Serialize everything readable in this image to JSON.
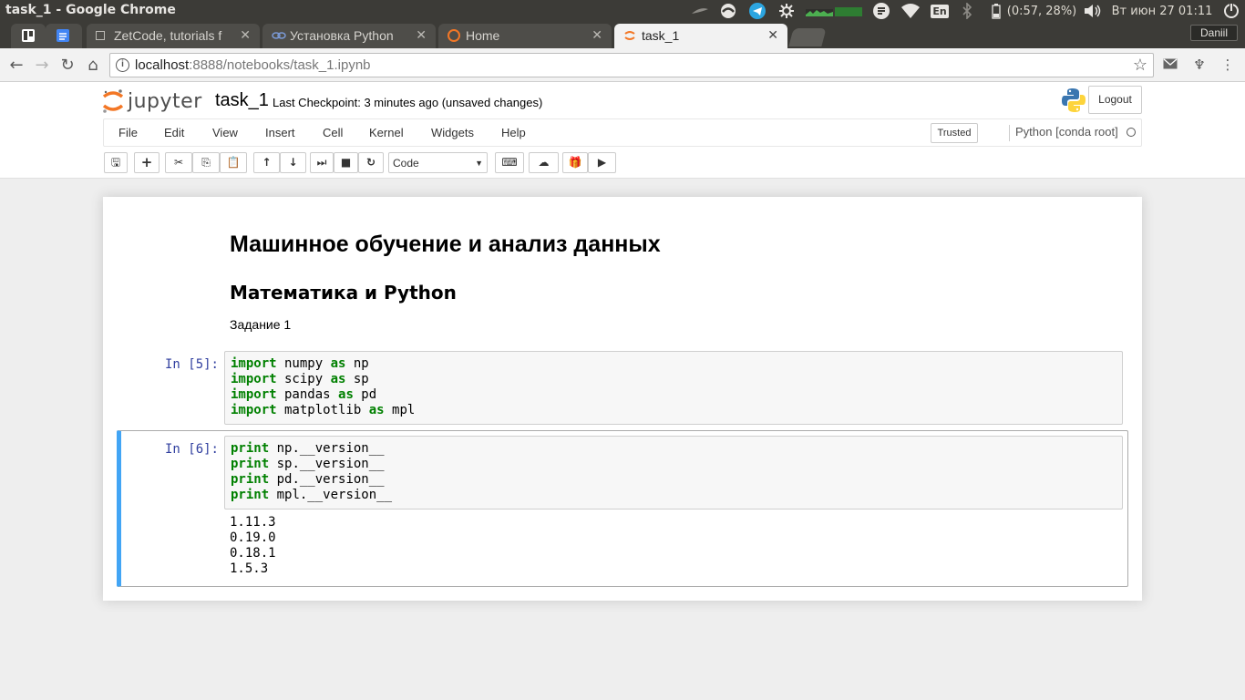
{
  "os": {
    "window_title": "task_1 - Google Chrome",
    "keyboard_layout": "En",
    "battery": "(0:57, 28%)",
    "datetime": "Вт июн 27 01:11"
  },
  "browser": {
    "tabs": [
      {
        "label": "",
        "favicon": "trello-icon"
      },
      {
        "label": "",
        "favicon": "docs-icon"
      },
      {
        "label": "ZetCode, tutorials f",
        "favicon": "zetcode-icon"
      },
      {
        "label": "Установка Python",
        "favicon": "python-site-icon"
      },
      {
        "label": "Home",
        "favicon": "jupyter-icon"
      },
      {
        "label": "task_1",
        "favicon": "jupyter-icon",
        "active": true
      }
    ],
    "user": "Daniil",
    "url_host": "localhost",
    "url_rest": ":8888/notebooks/task_1.ipynb"
  },
  "jupyter": {
    "wordmark": "jupyter",
    "notebook_name": "task_1",
    "checkpoint": "Last Checkpoint: 3 minutes ago (unsaved changes)",
    "logout": "Logout",
    "menu": [
      "File",
      "Edit",
      "View",
      "Insert",
      "Cell",
      "Kernel",
      "Widgets",
      "Help"
    ],
    "trusted": "Trusted",
    "kernel": "Python [conda root]",
    "cell_type": "Code"
  },
  "notebook": {
    "h1": "Машинное обучение и анализ данных",
    "h2": "Математика и Python",
    "paragraph": "Задание 1",
    "cell1": {
      "prompt": "In [5]:",
      "lines": [
        {
          "kw": "import",
          "a": " numpy ",
          "kw2": "as",
          "b": " np"
        },
        {
          "kw": "import",
          "a": " scipy ",
          "kw2": "as",
          "b": " sp"
        },
        {
          "kw": "import",
          "a": " pandas ",
          "kw2": "as",
          "b": " pd"
        },
        {
          "kw": "import",
          "a": " matplotlib ",
          "kw2": "as",
          "b": " mpl"
        }
      ]
    },
    "cell2": {
      "prompt": "In [6]:",
      "lines": [
        {
          "kw": "print",
          "a": " np.__version__"
        },
        {
          "kw": "print",
          "a": " sp.__version__"
        },
        {
          "kw": "print",
          "a": " pd.__version__"
        },
        {
          "kw": "print",
          "a": " mpl.__version__"
        }
      ],
      "output": [
        "1.11.3",
        "0.19.0",
        "0.18.1",
        "1.5.3"
      ]
    }
  }
}
